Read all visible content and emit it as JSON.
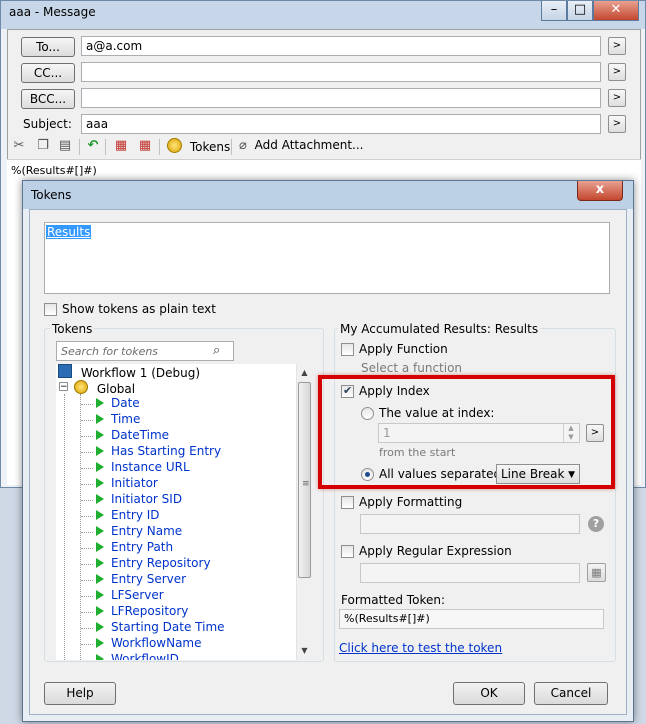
{
  "message_window": {
    "title": "aaa - Message",
    "to_label": "To...",
    "to_value": "a@a.com",
    "cc_label": "CC...",
    "cc_value": "",
    "bcc_label": "BCC...",
    "bcc_value": "",
    "subject_label": "Subject:",
    "subject_value": "aaa",
    "arrow_label": ">",
    "toolbar": {
      "tokens_label": "Tokens",
      "add_attachment_label": "Add Attachment..."
    },
    "body_text": "%(Results#[]#)"
  },
  "tokens_dialog": {
    "title": "Tokens",
    "close_label": "x",
    "preview_text": "Results",
    "show_plain_label": "Show tokens as plain text",
    "tokens_group_label": "Tokens",
    "search_placeholder": "Search for tokens",
    "tree": {
      "workflow_label": "Workflow 1 (Debug)",
      "global_label": "Global",
      "items": [
        "Date",
        "Time",
        "DateTime",
        "Has Starting Entry",
        "Instance URL",
        "Initiator",
        "Initiator SID",
        "Entry ID",
        "Entry Name",
        "Entry Path",
        "Entry Repository",
        "Entry Server",
        "LFServer",
        "LFRepository",
        "Starting Date Time",
        "WorkflowName",
        "WorkflowID"
      ]
    },
    "results_group_label": "My Accumulated Results: Results",
    "apply_function_label": "Apply Function",
    "select_function_label": "Select a function",
    "apply_index_label": "Apply Index",
    "value_at_index_label": "The value at index:",
    "index_value": "1",
    "from_start_label": "from the  start",
    "all_values_label": "All values separated by:",
    "separator_value": "Line Break",
    "apply_formatting_label": "Apply Formatting",
    "apply_regex_label": "Apply Regular Expression",
    "formatted_token_label": "Formatted Token:",
    "formatted_token_value": "%(Results#[]#)",
    "test_link_label": "Click here to test the token",
    "help_label": "Help",
    "ok_label": "OK",
    "cancel_label": "Cancel",
    "highlight_color": "#d40000"
  }
}
